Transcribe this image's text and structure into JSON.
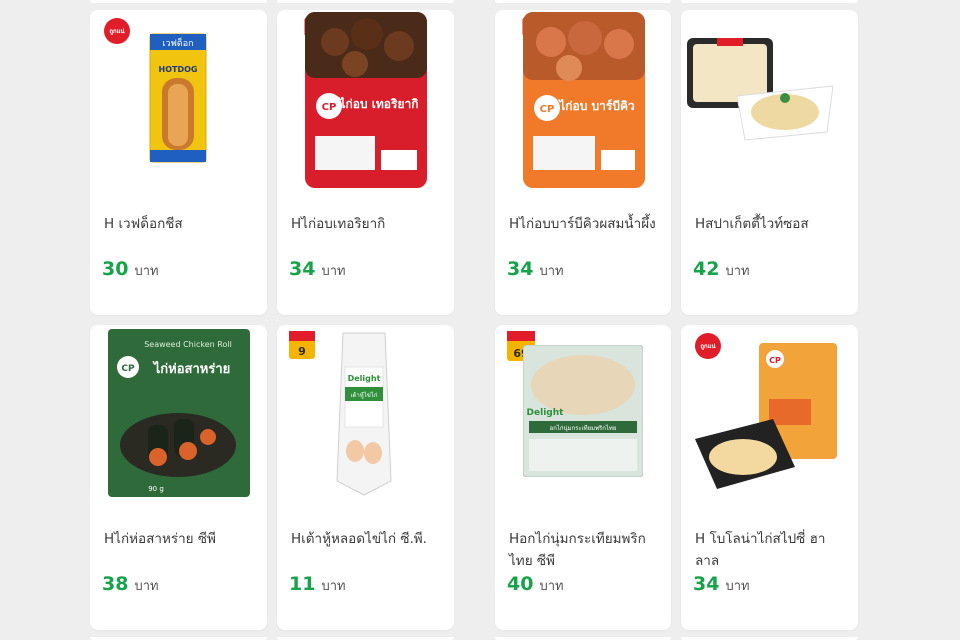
{
  "currency": "บาท",
  "products": [
    {
      "name": "H เวฟด็อกชีส",
      "price": "30"
    },
    {
      "name": "Hไก่อบเทอริยากิ",
      "price": "34"
    },
    {
      "name": "Hไก่อบบาร์บีคิวผสมน้ำผึ้ง",
      "price": "34"
    },
    {
      "name": "Hสปาเก็ตตี้ไวท์ซอส",
      "price": "42"
    },
    {
      "name": "Hไก่ห่อสาหร่าย ซีพี",
      "price": "38"
    },
    {
      "name": "Hเต้าหู้หลอดไข่ไก่ ซี.พี.",
      "price": "11"
    },
    {
      "name": "Hอกไก่นุ่มกระเทียมพริกไทย ซีพี",
      "price": "40"
    },
    {
      "name": "H โบโลน่าไก่สไปซี่ ฮาลาล",
      "price": "34"
    }
  ],
  "packaging": {
    "brand": "CP",
    "hotdog_label": "เวฟด็อก",
    "hotdog_sub": "HOTDOG",
    "teriyaki_label": "ไก่อบ เทอริยากิ",
    "bbq_label": "ไก่อบ บาร์บีคิว",
    "seaweed_en": "Seaweed Chicken Roll",
    "seaweed_th": "ไก่ห่อสาหร่าย",
    "delight_label": "Delight",
    "tofu_label": "เต้าหู้ไข่ไก่",
    "breast_label": "อกไก่นุ่มกระเทียมพริกไทย",
    "net_weight": "90 g",
    "badge_thuk": "ถูกแน่",
    "badge_price_9": "9",
    "badge_price_69": "69"
  },
  "colors": {
    "price": "#16a34a",
    "card": "#ffffff",
    "background": "#eeeeee"
  }
}
